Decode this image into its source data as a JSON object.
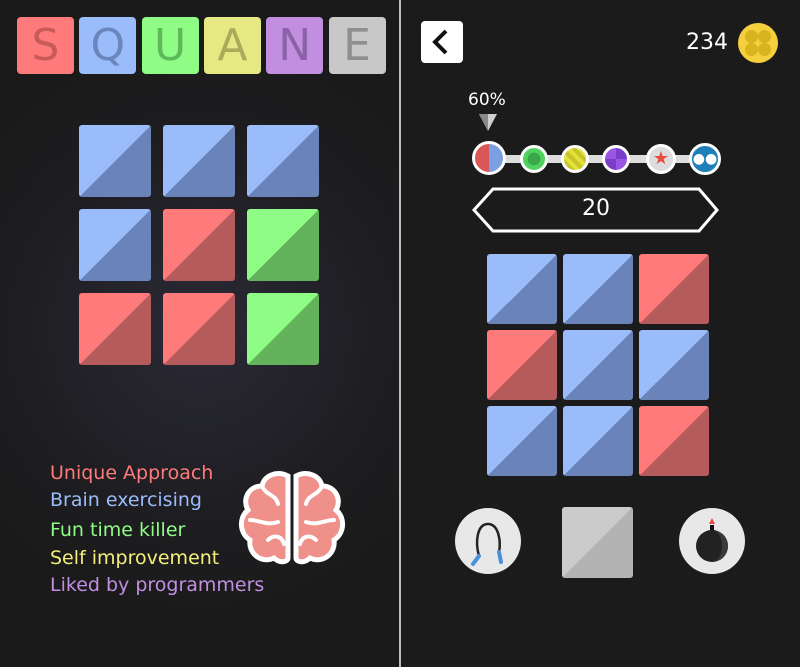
{
  "title_letters": [
    {
      "char": "S",
      "bg": "#ff7b7b",
      "fg": "#c85a5a"
    },
    {
      "char": "Q",
      "bg": "#9bbcfb",
      "fg": "#6a86bd"
    },
    {
      "char": "U",
      "bg": "#8ffc85",
      "fg": "#5fb95a"
    },
    {
      "char": "A",
      "bg": "#e6e884",
      "fg": "#a9ab5a"
    },
    {
      "char": "N",
      "bg": "#c18ee0",
      "fg": "#8a63a6"
    },
    {
      "char": "E",
      "bg": "#c8c8c8",
      "fg": "#8f8f8f"
    }
  ],
  "colors": {
    "blue": [
      "#9bbcfb",
      "#6a83b8"
    ],
    "red": [
      "#ff7b7b",
      "#b55b5b"
    ],
    "green": [
      "#8ffc85",
      "#63b35c"
    ],
    "gray": [
      "#cbcbcb",
      "#b3b3b3"
    ]
  },
  "demo_grid": [
    "blue",
    "blue",
    "blue",
    "blue",
    "red",
    "green",
    "red",
    "red",
    "green"
  ],
  "features": [
    {
      "text": "Unique Approach",
      "color": "#ff7b7b"
    },
    {
      "text": "Brain exercising",
      "color": "#9bbcfb"
    },
    {
      "text": "Fun time killer",
      "color": "#8ffc85"
    },
    {
      "text": "Self improvement",
      "color": "#f4ef7a"
    },
    {
      "text": "Liked by programmers",
      "color": "#c18ee0"
    }
  ],
  "game": {
    "coins": "234",
    "progress_label": "60%",
    "progress": 0.6,
    "moves": "20",
    "levels": [
      "red-blue",
      "green",
      "yellow",
      "purple",
      "star",
      "monkey"
    ],
    "grid": [
      "blue",
      "blue",
      "red",
      "red",
      "blue",
      "blue",
      "blue",
      "blue",
      "red"
    ],
    "powerups": [
      "jump-rope",
      "gray-tile",
      "bomb"
    ]
  }
}
